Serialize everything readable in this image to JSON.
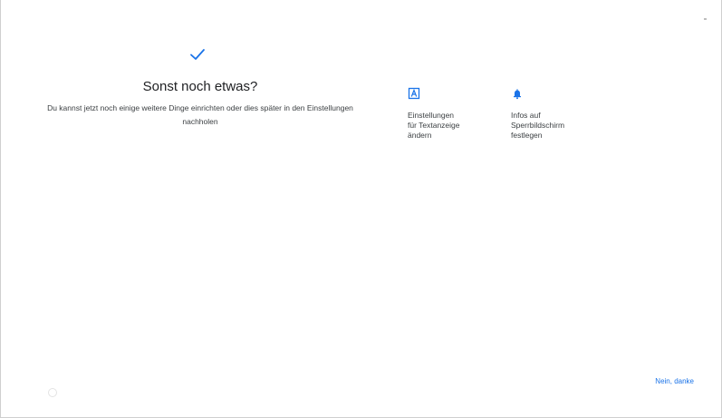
{
  "main": {
    "title": "Sonst noch etwas?",
    "description": "Du kannst jetzt noch einige weitere Dinge einrichten oder dies später in den Einstellungen nachholen"
  },
  "options": [
    {
      "icon": "text-display-icon",
      "label": "Einstellungen\nfür Textanzeige\nändern"
    },
    {
      "icon": "bell-icon",
      "label": "Infos auf\nSperrbildschirm\nfestlegen"
    }
  ],
  "footer": {
    "skip_label": "Nein, danke"
  },
  "colors": {
    "accent": "#1a73e8",
    "text": "#202124"
  }
}
